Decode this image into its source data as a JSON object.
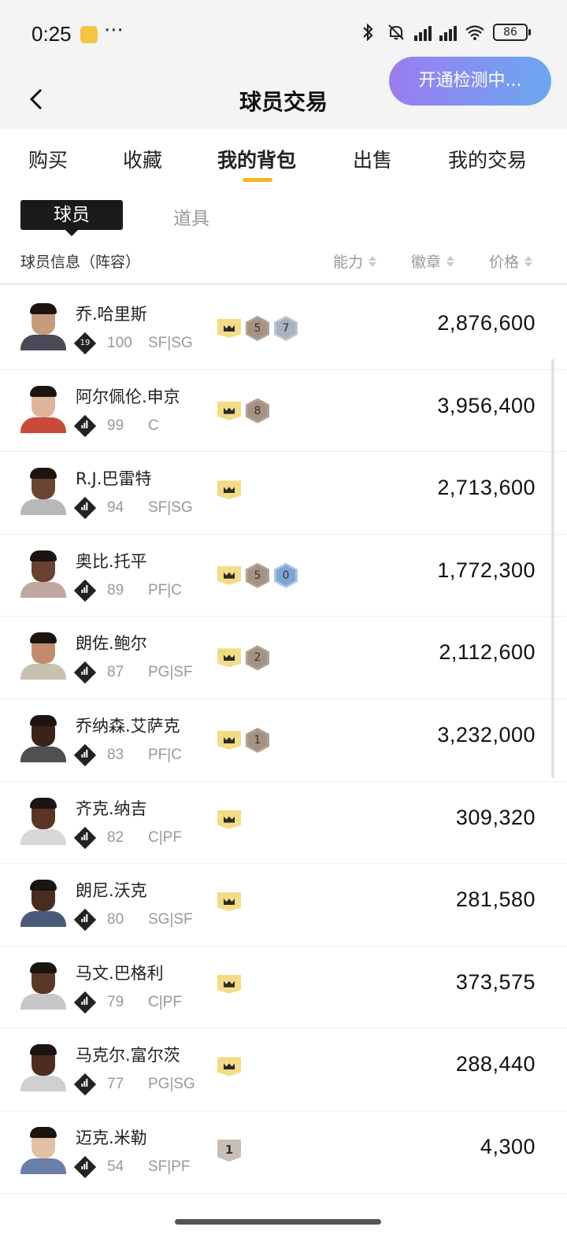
{
  "status_bar": {
    "time": "0:25",
    "dots": "···",
    "battery": "86",
    "icons": [
      "app-notification-icon",
      "bluetooth-icon",
      "mute-icon",
      "signal-hd-icon",
      "signal-icon",
      "wifi-icon",
      "battery-icon"
    ]
  },
  "header": {
    "title": "球员交易",
    "back_icon": "chevron-left-icon",
    "check_pill": "开通检测中..."
  },
  "tabs": [
    {
      "label": "购买",
      "active": false
    },
    {
      "label": "收藏",
      "active": false
    },
    {
      "label": "我的背包",
      "active": true
    },
    {
      "label": "出售",
      "active": false
    },
    {
      "label": "我的交易",
      "active": false
    }
  ],
  "subtabs": {
    "active": "球员",
    "other": "道具"
  },
  "columns": {
    "info": "球员信息（阵容）",
    "ability": "能力",
    "badge": "徽章",
    "price": "价格"
  },
  "accent_color": "#f5b720",
  "players": [
    {
      "name": "乔.哈里斯",
      "rank": "19",
      "rating": "100",
      "position": "SF|SG",
      "crown": true,
      "hexes": [
        {
          "n": "5",
          "c": "bronze"
        },
        {
          "n": "7",
          "c": "silver"
        }
      ],
      "price": "2,876,600"
    },
    {
      "name": "阿尔佩伦.申京",
      "rank": "",
      "rating": "99",
      "position": "C",
      "crown": true,
      "hexes": [
        {
          "n": "8",
          "c": "bronze"
        }
      ],
      "price": "3,956,400"
    },
    {
      "name": "R.J.巴雷特",
      "rank": "",
      "rating": "94",
      "position": "SF|SG",
      "crown": true,
      "hexes": [],
      "price": "2,713,600"
    },
    {
      "name": "奥比.托平",
      "rank": "",
      "rating": "89",
      "position": "PF|C",
      "crown": true,
      "hexes": [
        {
          "n": "5",
          "c": "bronze"
        },
        {
          "n": "0",
          "c": "blue"
        }
      ],
      "price": "1,772,300"
    },
    {
      "name": "朗佐.鲍尔",
      "rank": "",
      "rating": "87",
      "position": "PG|SF",
      "crown": true,
      "hexes": [
        {
          "n": "2",
          "c": "bronze"
        }
      ],
      "price": "2,112,600"
    },
    {
      "name": "乔纳森.艾萨克",
      "rank": "",
      "rating": "83",
      "position": "PF|C",
      "crown": true,
      "hexes": [
        {
          "n": "1",
          "c": "bronze"
        }
      ],
      "price": "3,232,000"
    },
    {
      "name": "齐克.纳吉",
      "rank": "",
      "rating": "82",
      "position": "C|PF",
      "crown": true,
      "hexes": [],
      "price": "309,320"
    },
    {
      "name": "朗尼.沃克",
      "rank": "",
      "rating": "80",
      "position": "SG|SF",
      "crown": true,
      "hexes": [],
      "price": "281,580"
    },
    {
      "name": "马文.巴格利",
      "rank": "",
      "rating": "79",
      "position": "C|PF",
      "crown": true,
      "hexes": [],
      "price": "373,575"
    },
    {
      "name": "马克尔.富尔茨",
      "rank": "",
      "rating": "77",
      "position": "PG|SG",
      "crown": true,
      "hexes": [],
      "price": "288,440"
    },
    {
      "name": "迈克.米勒",
      "rank": "",
      "rating": "54",
      "position": "SF|PF",
      "crown": false,
      "grey_badge": "1",
      "hexes": [],
      "price": "4,300"
    }
  ]
}
